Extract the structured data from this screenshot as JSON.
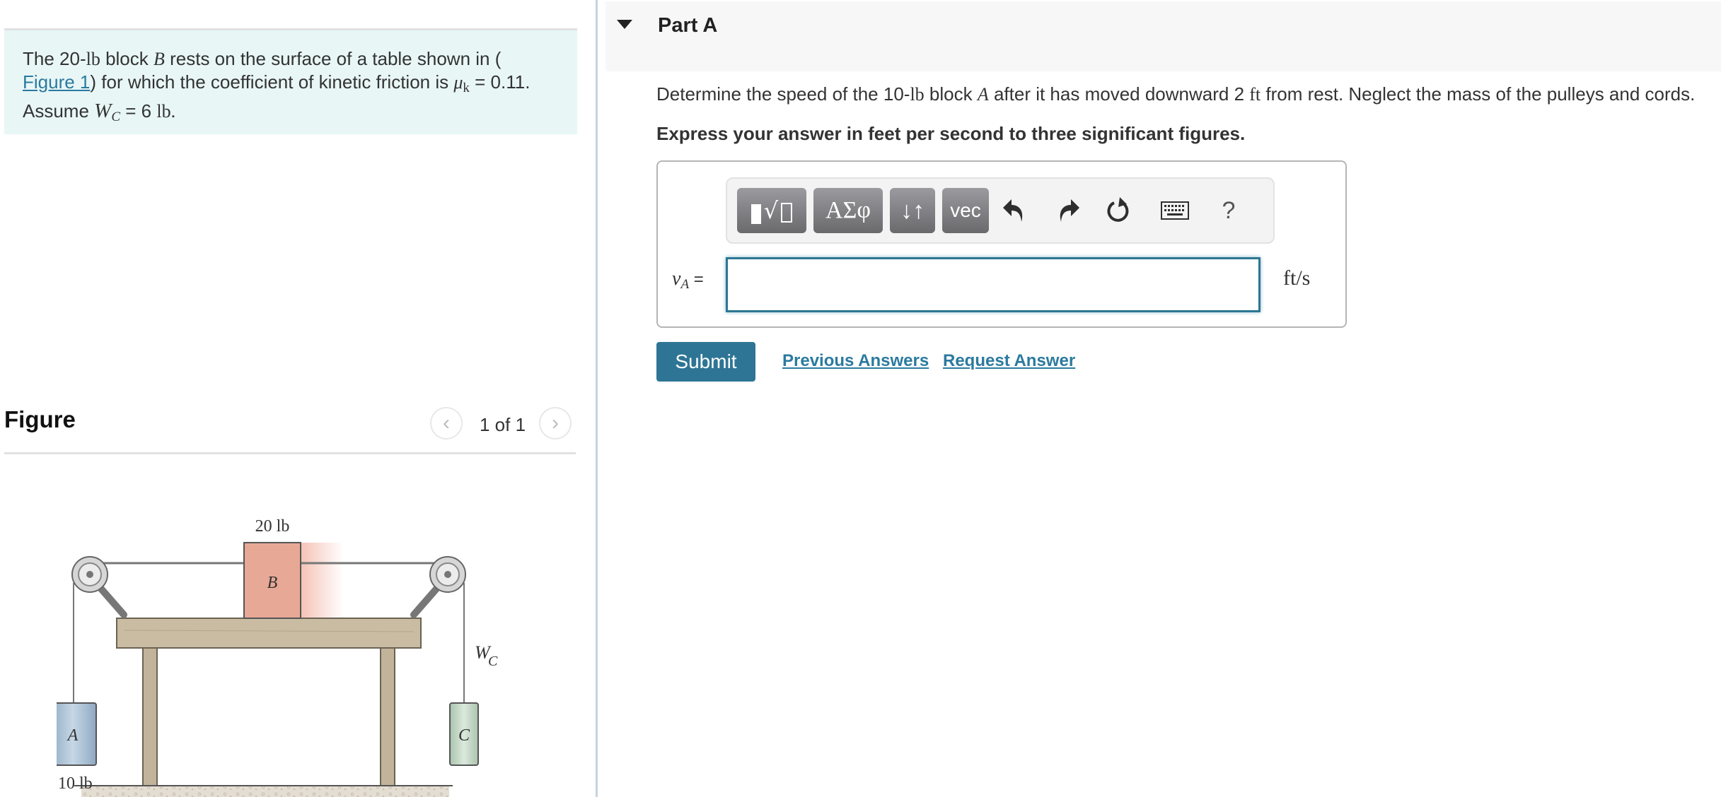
{
  "problem": {
    "text_before_link": "The 20-",
    "unit_lb": "lb",
    "text_block": " block ",
    "var_B": "B",
    "text_rest": " rests on the surface of a table shown in (",
    "link_label": "Figure 1",
    "text_after_link": ") for which the coefficient of kinetic friction is ",
    "mu_symbol": "μ",
    "mu_sub": "k",
    "mu_value": " = 0.11.",
    "assume_label": "Assume ",
    "wc_symbol": "W",
    "wc_sub": "C",
    "wc_value": " = 6 ",
    "wc_unit": "lb."
  },
  "figure": {
    "title": "Figure",
    "pager_text": "1 of 1",
    "prev_icon": "chevron-left",
    "next_icon": "chevron-right",
    "labels": {
      "block_b_weight": "20 lb",
      "block_b": "B",
      "block_a": "A",
      "block_a_weight": "10 lb",
      "block_c": "C",
      "wc_label": "W",
      "wc_sub": "C"
    },
    "colors": {
      "block_a": "#a9c1d6",
      "block_b": "#e8a896",
      "block_c": "#c7dcc9",
      "wood": "#c9bca3"
    }
  },
  "part": {
    "title": "Part A",
    "question_1": "Determine the speed of the 10-",
    "q_unit_lb": "lb",
    "question_2": " block ",
    "q_var_A": "A",
    "question_3": " after it has moved downward 2 ",
    "q_unit_ft": "ft",
    "question_4": " from rest. Neglect the mass of the pulleys and cords.",
    "instruction": "Express your answer in feet per second to three significant figures."
  },
  "answer": {
    "toolbar": {
      "templates_label": "▮∜▯",
      "greek_label": "ΑΣφ",
      "arrows_label": "↓↑",
      "vec_label": "vec",
      "help_label": "?"
    },
    "variable": "v",
    "variable_sub": "A",
    "equals": " =",
    "input_value": "",
    "unit": "ft/s"
  },
  "actions": {
    "submit": "Submit",
    "previous_answers": "Previous Answers",
    "request_answer": "Request Answer"
  },
  "colors": {
    "accent": "#2e7595",
    "link": "#2b7a9f",
    "problem_bg": "#e8f6f6"
  }
}
